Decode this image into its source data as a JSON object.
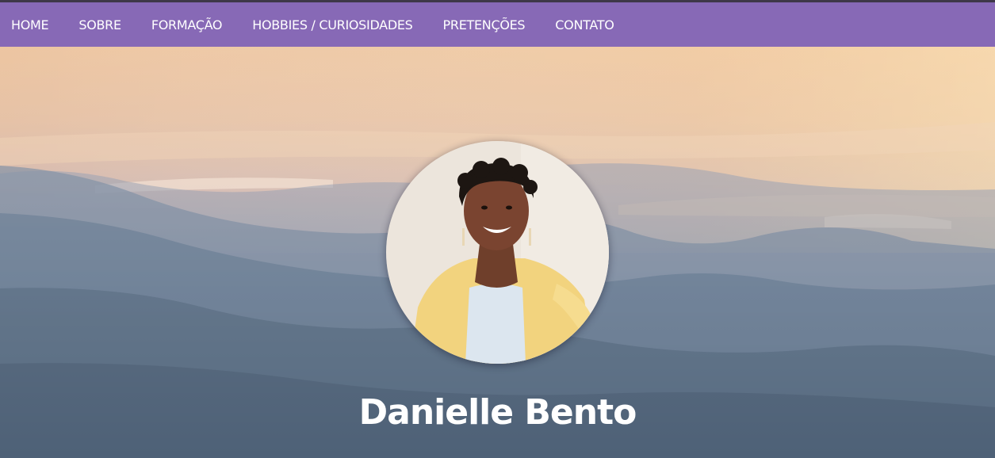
{
  "nav": {
    "items": [
      {
        "label": "HOME"
      },
      {
        "label": "SOBRE"
      },
      {
        "label": "FORMAÇÃO"
      },
      {
        "label": "HOBBIES / CURIOSIDADES"
      },
      {
        "label": "PRETENÇÕES"
      },
      {
        "label": "CONTATO"
      }
    ]
  },
  "hero": {
    "name": "Danielle Bento"
  },
  "colors": {
    "nav_background": "#8769b6",
    "nav_text": "#ffffff",
    "name_text": "#ffffff"
  }
}
